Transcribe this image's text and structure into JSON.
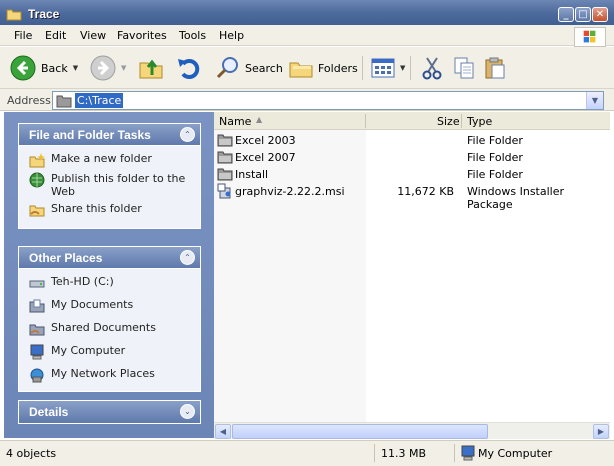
{
  "window": {
    "title": "Trace",
    "minimize": "_",
    "maximize": "□",
    "close": "✕"
  },
  "menu": {
    "items": [
      "File",
      "Edit",
      "View",
      "Favorites",
      "Tools",
      "Help"
    ]
  },
  "toolbar": {
    "back": "Back",
    "search": "Search",
    "folders": "Folders"
  },
  "address": {
    "label": "Address",
    "value": "C:\\Trace"
  },
  "tasks_panel": {
    "title": "File and Folder Tasks",
    "items": [
      "Make a new folder",
      "Publish this folder to the Web",
      "Share this folder"
    ]
  },
  "places_panel": {
    "title": "Other Places",
    "items": [
      "Teh-HD (C:)",
      "My Documents",
      "Shared Documents",
      "My Computer",
      "My Network Places"
    ]
  },
  "details_panel": {
    "title": "Details"
  },
  "columns": {
    "name": "Name",
    "size": "Size",
    "type": "Type"
  },
  "files": [
    {
      "name": "Excel 2003",
      "size": "",
      "type": "File Folder",
      "icon": "folder-icon"
    },
    {
      "name": "Excel 2007",
      "size": "",
      "type": "File Folder",
      "icon": "folder-icon"
    },
    {
      "name": "Install",
      "size": "",
      "type": "File Folder",
      "icon": "folder-icon"
    },
    {
      "name": "graphviz-2.22.2.msi",
      "size": "11,672 KB",
      "type": "Windows Installer Package",
      "icon": "installer-icon"
    }
  ],
  "status": {
    "count": "4 objects",
    "size": "11.3 MB",
    "location": "My Computer"
  },
  "colors": {
    "selection": "#316ac5",
    "title_bar": "#4d6a9c",
    "panel_bg": "#eff2f8"
  }
}
